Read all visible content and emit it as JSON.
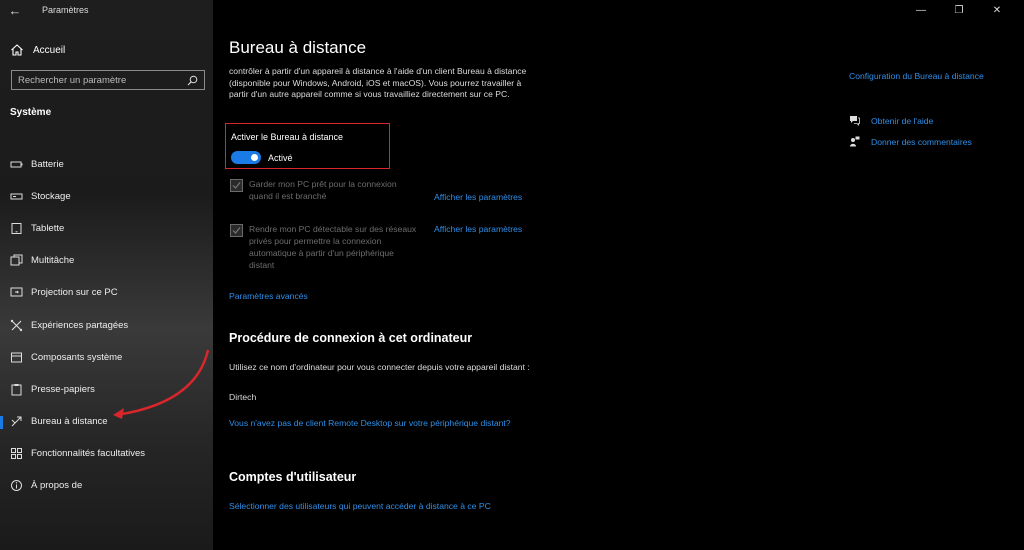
{
  "app": {
    "title": "Paramètres"
  },
  "window": {
    "minimize": "—",
    "maximize": "❐",
    "close": "✕"
  },
  "sidebar": {
    "home_label": "Accueil",
    "search_placeholder": "Rechercher un paramètre",
    "section_title": "Système",
    "items": [
      {
        "label": "Batterie",
        "icon": "battery-icon"
      },
      {
        "label": "Stockage",
        "icon": "storage-icon"
      },
      {
        "label": "Tablette",
        "icon": "tablet-icon"
      },
      {
        "label": "Multitâche",
        "icon": "multitask-icon"
      },
      {
        "label": "Projection sur ce PC",
        "icon": "projection-icon"
      },
      {
        "label": "Expériences partagées",
        "icon": "shared-experiences-icon"
      },
      {
        "label": "Composants système",
        "icon": "system-components-icon"
      },
      {
        "label": "Presse-papiers",
        "icon": "clipboard-icon"
      },
      {
        "label": "Bureau à distance",
        "icon": "remote-desktop-icon",
        "selected": true
      },
      {
        "label": "Fonctionnalités facultatives",
        "icon": "optional-features-icon"
      },
      {
        "label": "À propos de",
        "icon": "about-icon"
      }
    ]
  },
  "main": {
    "title": "Bureau à distance",
    "description": "contrôler à partir d'un appareil à distance à l'aide d'un client Bureau à distance (disponible pour Windows, Android, iOS et macOS). Vous pourrez travailler à partir d'un autre appareil comme si vous travailliez directement sur ce PC.",
    "toggle": {
      "label": "Activer le Bureau à distance",
      "state": "Activé",
      "on": true
    },
    "options": [
      {
        "text": "Garder mon PC prêt pour la connexion quand il est branché",
        "link": "Afficher les paramètres",
        "checked": true
      },
      {
        "text": "Rendre mon PC détectable sur des réseaux privés pour permettre la connexion automatique à partir d'un périphérique distant",
        "link": "Afficher les paramètres",
        "checked": true
      }
    ],
    "advanced_link": "Paramètres avancés",
    "connection": {
      "heading": "Procédure de connexion à cet ordinateur",
      "text": "Utilisez ce nom d'ordinateur pour vous connecter depuis votre appareil distant :",
      "computer_name": "Dirtech",
      "client_link": "Vous n'avez pas de client Remote Desktop sur votre périphérique distant?"
    },
    "accounts": {
      "heading": "Comptes d'utilisateur",
      "link": "Sélectionner des utilisateurs qui peuvent accéder à distance à ce PC"
    }
  },
  "right": {
    "config_link": "Configuration du Bureau à distance",
    "help_link": "Obtenir de l'aide",
    "feedback_link": "Donner des commentaires"
  },
  "colors": {
    "accent": "#1a7be6",
    "link": "#2f8fe8",
    "annotation_red": "#d9262c"
  }
}
